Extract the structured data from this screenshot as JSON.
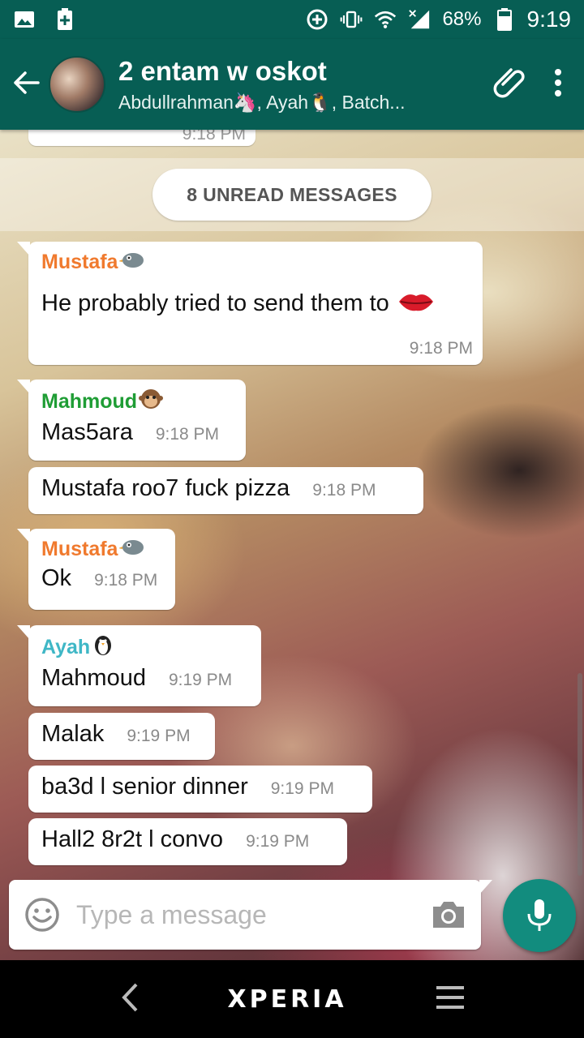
{
  "status_bar": {
    "battery": "68%",
    "time": "9:19"
  },
  "header": {
    "title": "2 entam w oskot",
    "subtitle": "Abdullrahman🦄, Ayah🐧, Batch..."
  },
  "previous_message": {
    "time": "9:18 PM"
  },
  "unread_banner": "8 UNREAD MESSAGES",
  "messages": [
    {
      "sender": "Mustafa",
      "sender_color": "#f07a2e",
      "text": "He probably tried to send them to",
      "time": "9:18 PM"
    },
    {
      "sender": "Mahmoud",
      "sender_color": "#1f9d35",
      "text": "Mas5ara",
      "time": "9:18 PM"
    },
    {
      "text": "Mustafa roo7 fuck pizza",
      "time": "9:18 PM"
    },
    {
      "sender": "Mustafa",
      "sender_color": "#f07a2e",
      "text": "Ok",
      "time": "9:18 PM"
    },
    {
      "sender": "Ayah",
      "sender_color": "#3fb7c6",
      "text": "Mahmoud",
      "time": "9:19 PM"
    },
    {
      "text": "Malak",
      "time": "9:19 PM"
    },
    {
      "text": "ba3d l senior dinner",
      "time": "9:19 PM"
    },
    {
      "text": "Hall2 8r2t l convo",
      "time": "9:19 PM"
    }
  ],
  "composer": {
    "placeholder": "Type a message"
  },
  "nav": {
    "brand": "XPERIA"
  },
  "icons": {
    "back": "arrow-left-icon",
    "attach": "paperclip-icon",
    "menu": "more-vert-icon",
    "emoji": "smiley-icon",
    "camera": "camera-icon",
    "mic": "mic-icon"
  },
  "colors": {
    "primary": "#075e54",
    "accent": "#128c7e"
  }
}
